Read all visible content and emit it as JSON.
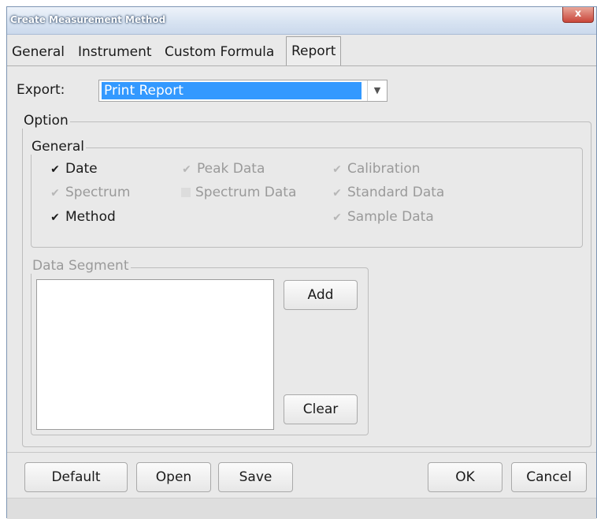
{
  "window": {
    "title": "Create Measurement Method",
    "close_label": "x"
  },
  "tabs": [
    {
      "label": "General",
      "active": false
    },
    {
      "label": "Instrument",
      "active": false
    },
    {
      "label": "Custom Formula",
      "active": false
    },
    {
      "label": "Report",
      "active": true
    }
  ],
  "export": {
    "label": "Export:",
    "value": "Print Report"
  },
  "option": {
    "legend": "Option",
    "general": {
      "legend": "General",
      "checkboxes": [
        {
          "label": "Date",
          "checked": true,
          "enabled": true
        },
        {
          "label": "Peak Data",
          "checked": true,
          "enabled": false
        },
        {
          "label": "Calibration",
          "checked": true,
          "enabled": false
        },
        {
          "label": "Spectrum",
          "checked": true,
          "enabled": false
        },
        {
          "label": "Spectrum Data",
          "checked": false,
          "enabled": false
        },
        {
          "label": "Standard Data",
          "checked": true,
          "enabled": false
        },
        {
          "label": "Method",
          "checked": true,
          "enabled": true
        },
        {
          "label": "Sample Data",
          "checked": true,
          "enabled": false
        }
      ]
    },
    "data_segment": {
      "legend": "Data Segment",
      "add_label": "Add",
      "clear_label": "Clear"
    }
  },
  "footer": {
    "default_label": "Default",
    "open_label": "Open",
    "save_label": "Save",
    "ok_label": "OK",
    "cancel_label": "Cancel"
  },
  "icons": {
    "checkmark": "check-icon",
    "dropdown": "chevron-down-icon",
    "close": "close-icon"
  }
}
